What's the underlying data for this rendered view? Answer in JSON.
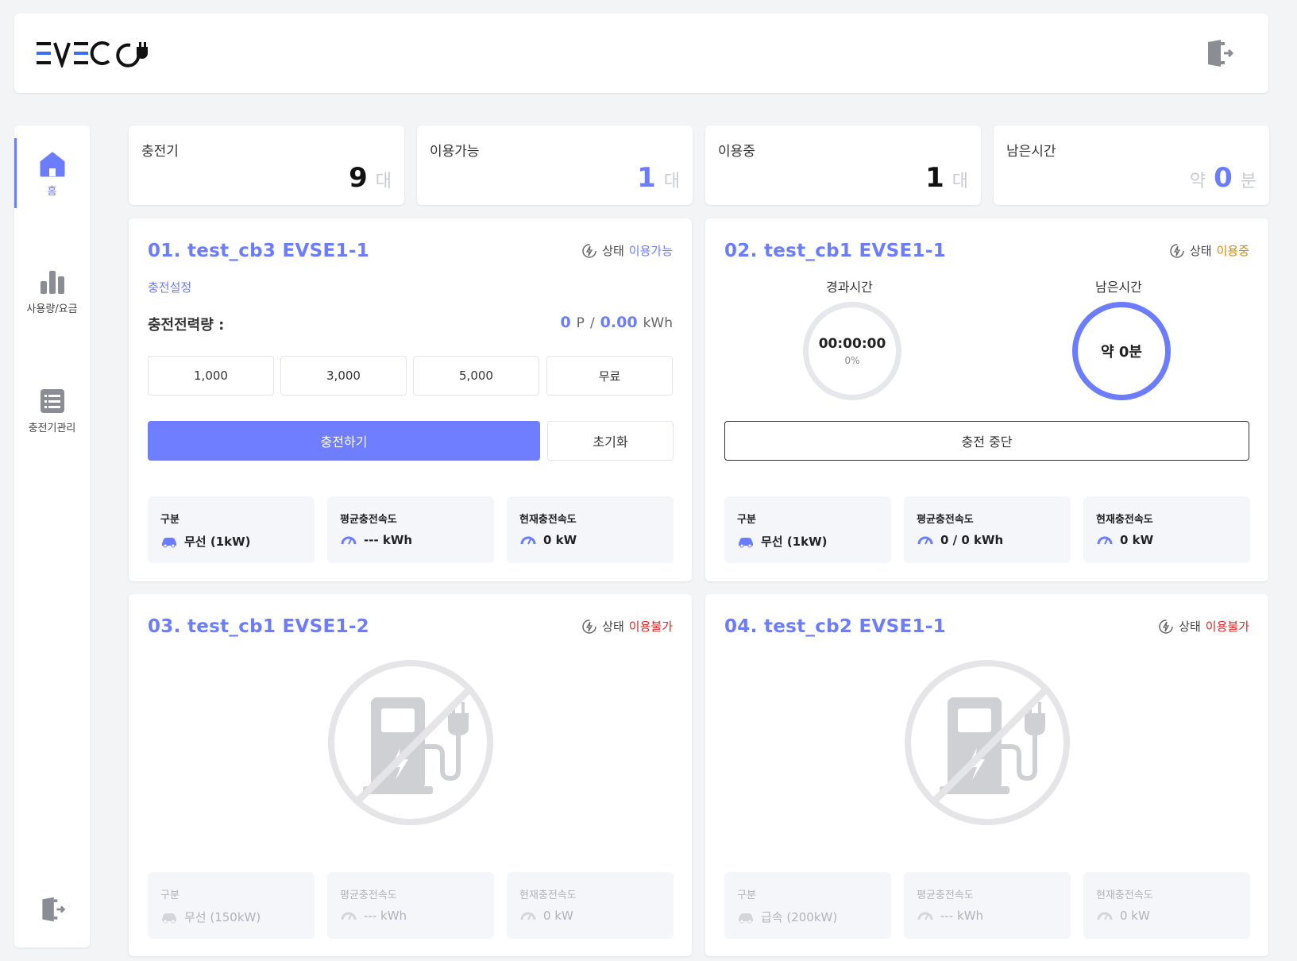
{
  "header": {
    "logo_text": "EVECO"
  },
  "sidebar": {
    "items": [
      {
        "label": "홈"
      },
      {
        "label": "사용량/요금"
      },
      {
        "label": "충전기관리"
      }
    ]
  },
  "stats": [
    {
      "title": "충전기",
      "prefix": "",
      "value": "9",
      "unit": "대",
      "color": "#111111"
    },
    {
      "title": "이용가능",
      "prefix": "",
      "value": "1",
      "unit": "대",
      "color": "#6b7cff"
    },
    {
      "title": "이용중",
      "prefix": "",
      "value": "1",
      "unit": "대",
      "color": "#111111"
    },
    {
      "title": "남은시간",
      "prefix": "약",
      "value": "0",
      "unit": "분",
      "color": "#6b7cff"
    }
  ],
  "status_label": "상태",
  "info_labels": {
    "type": "구분",
    "avg": "평균충전속도",
    "cur": "현재충전속도"
  },
  "chargers": [
    {
      "title": "01. test_cb3 EVSE1-1",
      "status": "이용가능",
      "setting_link": "충전설정",
      "energy_label": "충전전력량 :",
      "points": "0",
      "points_unit": "P",
      "sep": "/",
      "kwh": "0.00",
      "kwh_unit": "kWh",
      "amounts": [
        "1,000",
        "3,000",
        "5,000",
        "무료"
      ],
      "charge_button": "충전하기",
      "reset_button": "초기화",
      "type": "무선 (1kW)",
      "avg": "--- kWh",
      "cur": "0 kW"
    },
    {
      "title": "02. test_cb1 EVSE1-1",
      "status": "이용중",
      "elapsed_label": "경과시간",
      "elapsed": "00:00:00",
      "elapsed_pct": "0%",
      "remain_label": "남은시간",
      "remain": "약 0분",
      "stop_button": "충전 중단",
      "type": "무선 (1kW)",
      "avg": "0 / 0 kWh",
      "cur": "0 kW"
    },
    {
      "title": "03. test_cb1 EVSE1-2",
      "status": "이용불가",
      "type": "무선 (150kW)",
      "avg": "--- kWh",
      "cur": "0 kW"
    },
    {
      "title": "04. test_cb2 EVSE1-1",
      "status": "이용불가",
      "type": "급속 (200kW)",
      "avg": "--- kWh",
      "cur": "0 kW"
    }
  ],
  "icons": [
    "home-icon",
    "bar-chart-icon",
    "list-icon",
    "logout-icon",
    "plug-bolt-icon",
    "car-icon",
    "gauge-icon",
    "no-charging-icon"
  ]
}
